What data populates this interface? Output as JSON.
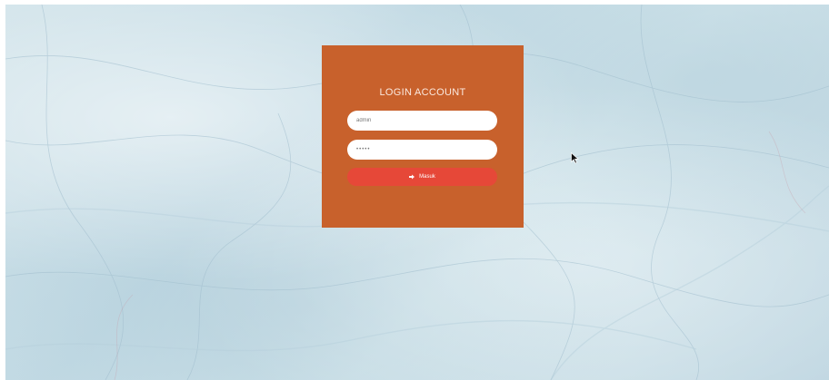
{
  "login": {
    "title": "LOGIN ACCOUNT",
    "username_value": "admin",
    "password_value": "•••••",
    "submit_label": "Masuk",
    "submit_icon": "sign-in-icon"
  },
  "colors": {
    "panel": "#c8612c",
    "button": "#e64838",
    "background": "#c8dfe7"
  }
}
